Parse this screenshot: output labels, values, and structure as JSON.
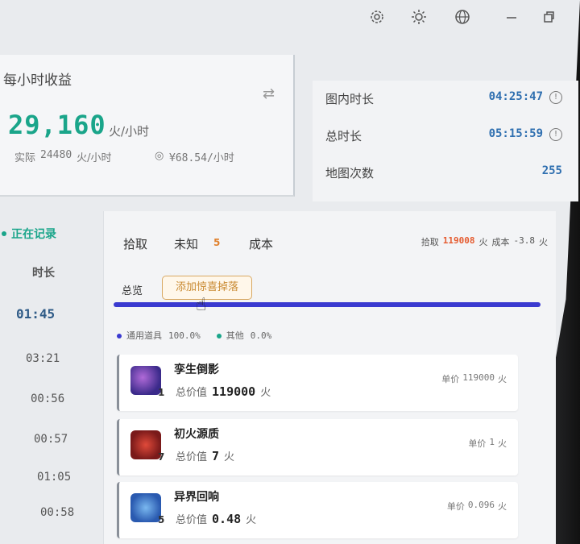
{
  "titlebar": {
    "icons": [
      "gear-icon",
      "sun-icon",
      "globe-icon",
      "minimize-icon",
      "restore-icon"
    ]
  },
  "hourly": {
    "title": "每小时收益",
    "rate": "29,160",
    "rate_unit": "火/小时",
    "actual_label": "实际",
    "actual_value": "24480",
    "actual_unit": "火/小时",
    "money": "¥68.54/小时"
  },
  "stats": {
    "in_map_label": "图内时长",
    "in_map_value": "04:25:47",
    "total_label": "总时长",
    "total_value": "05:15:59",
    "maps_label": "地图次数",
    "maps_value": "255"
  },
  "left": {
    "recording": "正在记录",
    "duration_header": "时长",
    "times": [
      "01:45",
      "03:21",
      "00:56",
      "00:57",
      "01:05",
      "00:58"
    ]
  },
  "main": {
    "tabs": [
      "拾取",
      "未知",
      "成本"
    ],
    "unknown_count": "5",
    "summary_pick_label": "拾取",
    "summary_pick_value": "119008",
    "summary_pick_unit": "火",
    "summary_cost_label": "成本",
    "summary_cost_value": "-3.8",
    "summary_cost_unit": "火",
    "overview": "总览",
    "add_button": "添加惊喜掉落",
    "progress": 1.0,
    "legend": [
      {
        "label": "通用道具",
        "value": "100.0%",
        "color": "#3a3ad0"
      },
      {
        "label": "其他",
        "value": "0.0%",
        "color": "#1aa58a"
      }
    ],
    "total_label": "总价值",
    "unit_label": "单价",
    "currency": "火",
    "items": [
      {
        "name": "孪生倒影",
        "qty": "1",
        "total": "119000",
        "unit_price": "119000",
        "color": "#4a3aa0"
      },
      {
        "name": "初火源质",
        "qty": "7",
        "total": "7",
        "unit_price": "1",
        "color": "#c0302a"
      },
      {
        "name": "异界回响",
        "qty": "5",
        "total": "0.48",
        "unit_price": "0.096",
        "color": "#3a7ad8"
      }
    ]
  }
}
